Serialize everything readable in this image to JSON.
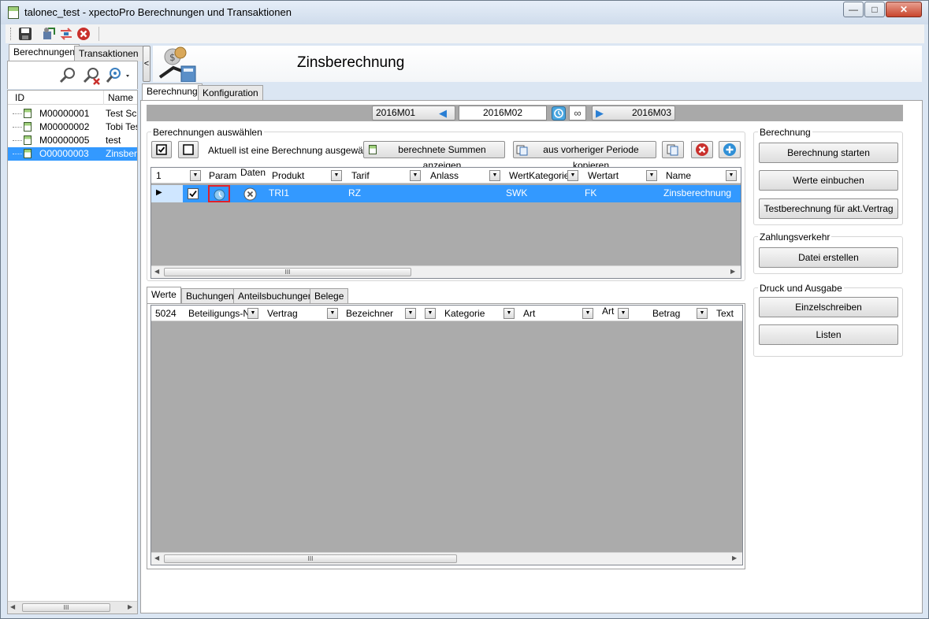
{
  "window": {
    "title": "talonec_test - xpectoPro Berechnungen und Transaktionen",
    "minimize": "—",
    "maximize": "□",
    "close": "✕"
  },
  "left": {
    "tabs": [
      "Berechnungen",
      "Transaktionen"
    ],
    "collapse": "<",
    "columns": {
      "id": "ID",
      "name": "Name"
    },
    "rows": [
      {
        "id": "M00000001",
        "name": "Test Scr"
      },
      {
        "id": "M00000002",
        "name": "Tobi Tes"
      },
      {
        "id": "M00000005",
        "name": "test"
      },
      {
        "id": "O00000003",
        "name": "Zinsbere"
      }
    ],
    "scroll_grip": "III"
  },
  "header": {
    "title": "Zinsberechnung"
  },
  "tabs": [
    "Berechnung",
    "Konfiguration"
  ],
  "period": {
    "prev": "2016M01",
    "current": "2016M02",
    "next": "2016M03",
    "infinity": "∞"
  },
  "select_group": {
    "label": "Berechnungen auswählen",
    "status": "Aktuell ist eine Berechnung ausgewählt",
    "btn_sums": "berechnete Summen anzeigen",
    "btn_copy": "aus vorheriger Periode kopieren",
    "count": "1",
    "columns": [
      "Param",
      "Daten",
      "Produkt",
      "Tarif",
      "Anlass",
      "WertKategorie",
      "Wertart",
      "Name"
    ],
    "row": {
      "produkt": "TRI1",
      "tarif": "RZ",
      "anlass": "",
      "wertkategorie": "SWK",
      "wertart": "FK",
      "name": "Zinsberechnung"
    },
    "scroll_grip": "III"
  },
  "lower_tabs": [
    "Werte",
    "Buchungen",
    "Anteilsbuchungen",
    "Belege"
  ],
  "werte": {
    "count": "5024",
    "columns": [
      "Beteiligungs-Nr",
      "Vertrag",
      "Bezeichner",
      "Kategorie",
      "Art",
      "Art",
      "Betrag",
      "Text"
    ],
    "scroll_grip": "III"
  },
  "berechnung": {
    "label": "Berechnung",
    "btn_start": "Berechnung starten",
    "btn_book": "Werte einbuchen",
    "btn_test": "Testberechnung für akt.Vertrag"
  },
  "zahlung": {
    "label": "Zahlungsverkehr",
    "btn_file": "Datei erstellen"
  },
  "druck": {
    "label": "Druck und Ausgabe",
    "btn_single": "Einzelschreiben",
    "btn_lists": "Listen"
  },
  "colors": {
    "selection": "#3399ff",
    "grid_bg": "#ababab",
    "highlight_border": "#e0202a"
  }
}
